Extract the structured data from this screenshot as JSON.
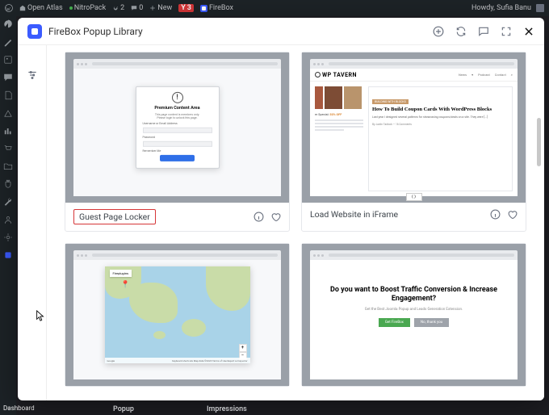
{
  "wp_bar": {
    "site_title": "Open Atlas",
    "nitropack": "NitroPack",
    "updates_count": "2",
    "comments_count": "0",
    "new_label": "New",
    "yoast_badge": "3",
    "firebox_label": "FireBox",
    "greeting": "Howdy, Sufia Banu"
  },
  "sidebar_label": "Dashboard",
  "modal": {
    "title": "FireBox Popup Library"
  },
  "cards": {
    "guest_locker": {
      "title": "Guest Page Locker",
      "premium_heading": "Premium Content Area",
      "premium_sub1": "This page content is members only.",
      "premium_sub2": "Please login to unlock this page.",
      "label_username": "Username or Email Address",
      "label_password": "Password",
      "remember": "Remember Me"
    },
    "iframe": {
      "title": "Load Website in iFrame",
      "brand": "TAVERN",
      "menu1": "News",
      "menu2": "Podcast",
      "menu3": "Contact",
      "tag": "BUILDING WITH BLOCKS",
      "headline": "How To Build Coupon Cards With WordPress Blocks",
      "desc": "Last year I designed several patterns for showcasing coupons/deals on a site. They were [...]",
      "meta": "By Justin Tadlock — 18 Comments",
      "special_label": "er Special:",
      "special_value": "50% OFF"
    },
    "map": {
      "popup_text": "Fireplugins",
      "attrib_left": "Google",
      "attrib_right": "Keyboard shortcuts   Map data ©2023  Terms of Use  Report a map error"
    },
    "boost": {
      "heading": "Do you want to Boost Traffic Conversion & Increase Engagement?",
      "sub": "Get the Best Joomla Popup and Leads Generation Extension.",
      "btn_primary": "Get FireBox",
      "btn_secondary": "No, thank you"
    }
  },
  "lower": {
    "col1": "Popup",
    "col2": "Impressions"
  }
}
